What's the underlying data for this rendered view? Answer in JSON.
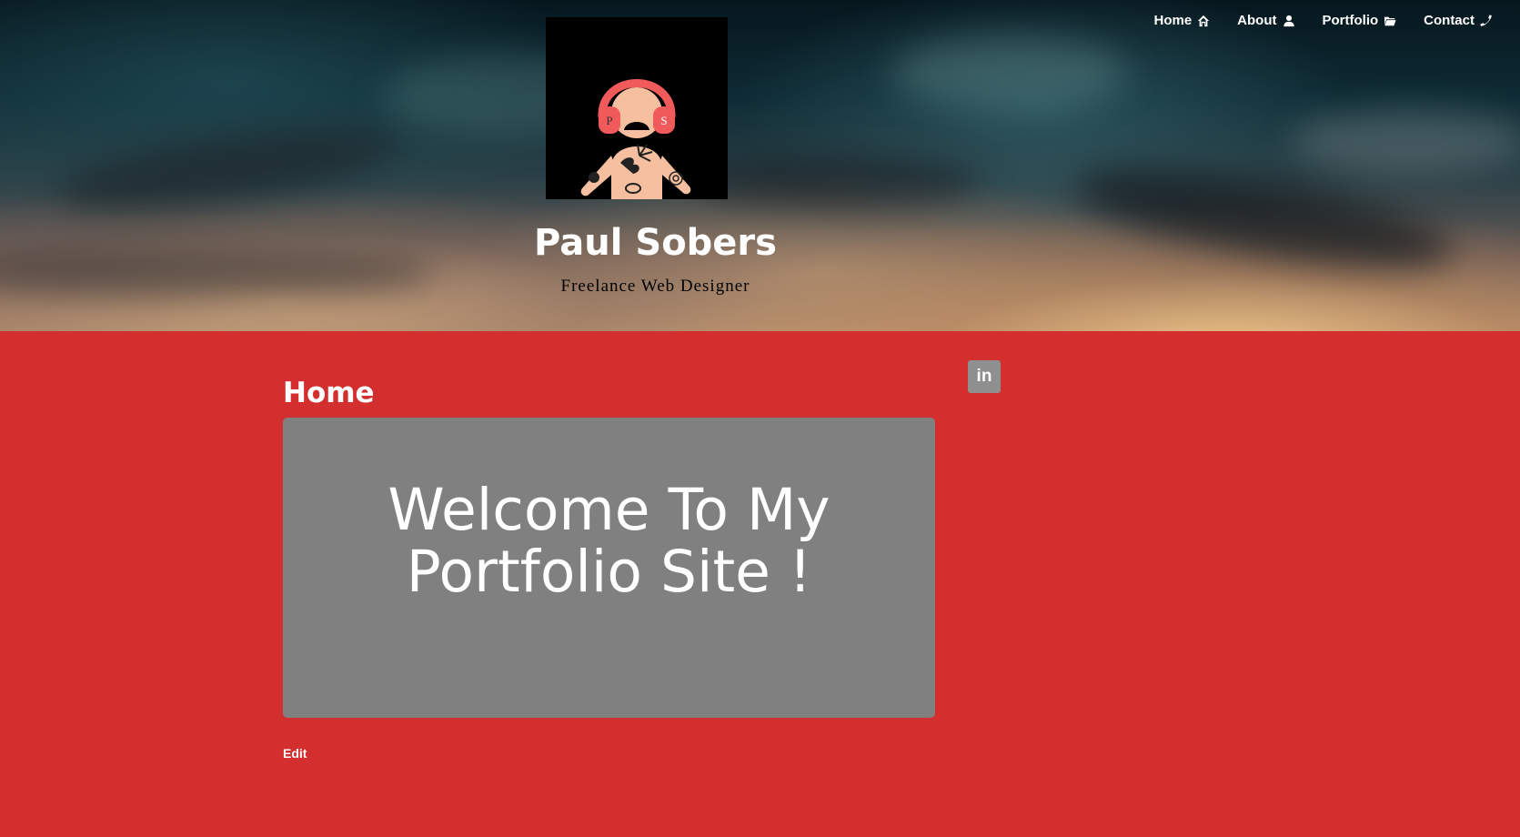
{
  "nav": {
    "items": [
      {
        "label": "Home",
        "icon": "home-icon"
      },
      {
        "label": "About",
        "icon": "user-icon"
      },
      {
        "label": "Portfolio",
        "icon": "folder-icon"
      },
      {
        "label": "Contact",
        "icon": "phone-icon"
      }
    ]
  },
  "header": {
    "logo_letters": [
      "P",
      "S"
    ],
    "name": "Paul Sobers",
    "tagline": "Freelance Web Designer"
  },
  "main": {
    "page_title": "Home",
    "welcome_line1": "Welcome To My",
    "welcome_line2": "Portfolio Site !",
    "edit_label": "Edit"
  },
  "social": {
    "linkedin_label": "in"
  },
  "colors": {
    "page_background": "#d32f2f",
    "welcome_box": "#808080",
    "linkedin_badge": "#8f8f8f",
    "logo_headphones": "#f15a5a",
    "logo_skin": "#f6c0a0"
  }
}
